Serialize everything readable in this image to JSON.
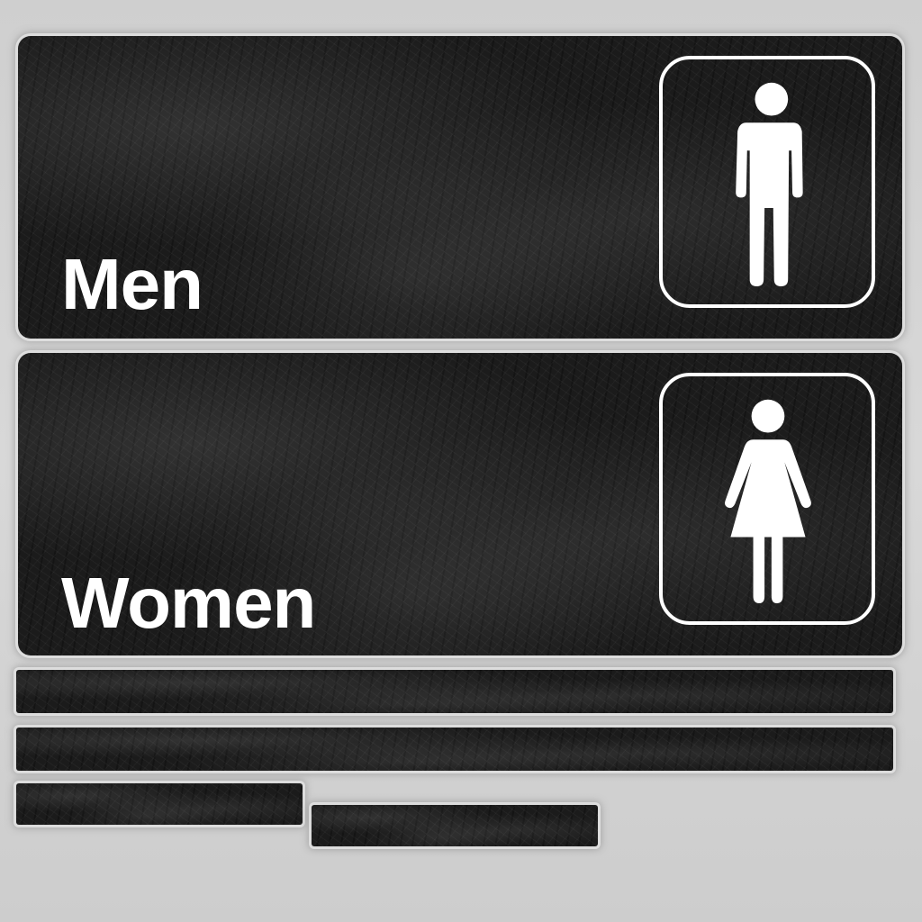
{
  "signs": {
    "men": {
      "label": "Men",
      "icon": "male-figure-icon"
    },
    "women": {
      "label": "Women",
      "icon": "female-figure-icon"
    }
  },
  "colors": {
    "sign_background": "#1b1b1b",
    "sign_text": "#ffffff",
    "canvas_background": "#d2d2d2"
  }
}
